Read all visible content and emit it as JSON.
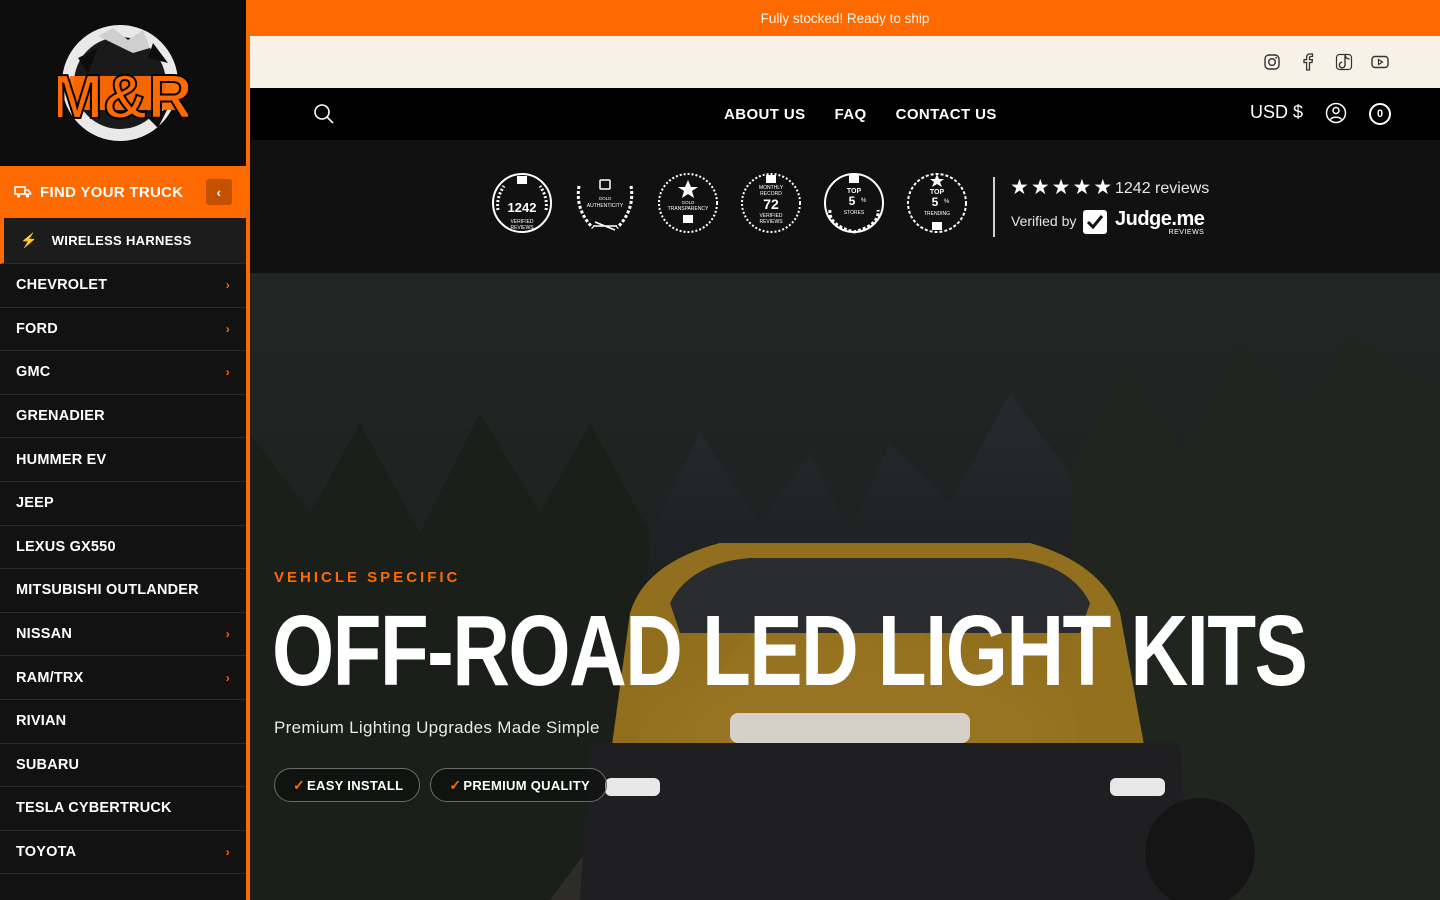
{
  "announcement": "Fully stocked! Ready to ship",
  "logo": {
    "text": "M&R"
  },
  "sidebar": {
    "find_truck_label": "FIND YOUR TRUCK",
    "collapse_glyph": "‹",
    "featured_item": "WIRELESS HARNESS",
    "items": [
      {
        "label": "CHEVROLET",
        "has_children": true
      },
      {
        "label": "FORD",
        "has_children": true
      },
      {
        "label": "GMC",
        "has_children": true
      },
      {
        "label": "GRENADIER",
        "has_children": false
      },
      {
        "label": "HUMMER EV",
        "has_children": false
      },
      {
        "label": "JEEP",
        "has_children": false
      },
      {
        "label": "LEXUS GX550",
        "has_children": false
      },
      {
        "label": "MITSUBISHI OUTLANDER",
        "has_children": false
      },
      {
        "label": "NISSAN",
        "has_children": true
      },
      {
        "label": "RAM/TRX",
        "has_children": true
      },
      {
        "label": "RIVIAN",
        "has_children": false
      },
      {
        "label": "SUBARU",
        "has_children": false
      },
      {
        "label": "TESLA CYBERTRUCK",
        "has_children": false
      },
      {
        "label": "TOYOTA",
        "has_children": true
      }
    ]
  },
  "social": [
    "instagram-icon",
    "facebook-icon",
    "tiktok-icon",
    "youtube-icon"
  ],
  "nav": {
    "links": [
      "ABOUT US",
      "FAQ",
      "CONTACT US"
    ],
    "currency": "USD $",
    "cart_count": "0"
  },
  "reviews": {
    "badges": [
      {
        "name": "verified-reviews",
        "big": "1242",
        "small": "VERIFIED REVIEWS"
      },
      {
        "name": "gold-authenticity",
        "big": "",
        "small": "GOLD AUTHENTICITY"
      },
      {
        "name": "gold-transparency",
        "big": "",
        "small": "GOLD TRANSPARENCY"
      },
      {
        "name": "monthly-record",
        "big": "72",
        "small": "MONTHLY RECORD",
        "small2": "VERIFIED REVIEWS"
      },
      {
        "name": "top-stores",
        "big": "5",
        "small": "TOP",
        "small2": "STORES"
      },
      {
        "name": "top-trending",
        "big": "5",
        "small": "TOP",
        "small2": "TRENDING"
      }
    ],
    "rating_stars": 5,
    "count_text": "1242 reviews",
    "verified_by": "Verified by",
    "provider": "Judge.me",
    "provider_sub": "REVIEWS"
  },
  "hero": {
    "eyebrow": "VEHICLE SPECIFIC",
    "title": "OFF-ROAD LED LIGHT KITS",
    "subtitle": "Premium Lighting Upgrades Made Simple",
    "pills": [
      "EASY INSTALL",
      "PREMIUM QUALITY"
    ]
  },
  "colors": {
    "accent": "#ff6a00",
    "cream": "#f7f1e7",
    "dark": "#111111"
  }
}
